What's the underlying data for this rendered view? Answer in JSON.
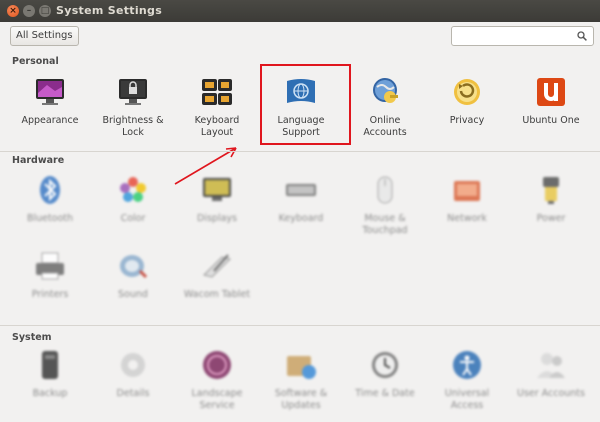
{
  "window": {
    "title": "System Settings"
  },
  "toolbar": {
    "all_settings": "All Settings",
    "search_placeholder": ""
  },
  "sections": {
    "personal": "Personal",
    "hardware": "Hardware",
    "system": "System"
  },
  "personal": [
    {
      "label": "Appearance"
    },
    {
      "label": "Brightness &\nLock"
    },
    {
      "label": "Keyboard\nLayout"
    },
    {
      "label": "Language\nSupport"
    },
    {
      "label": "Online\nAccounts"
    },
    {
      "label": "Privacy"
    },
    {
      "label": "Ubuntu One"
    }
  ],
  "hardware": [
    {
      "label": "Bluetooth"
    },
    {
      "label": "Color"
    },
    {
      "label": "Displays"
    },
    {
      "label": "Keyboard"
    },
    {
      "label": "Mouse &\nTouchpad"
    },
    {
      "label": "Network"
    },
    {
      "label": "Power"
    },
    {
      "label": "Printers"
    },
    {
      "label": "Sound"
    },
    {
      "label": "Wacom Tablet"
    }
  ],
  "system": [
    {
      "label": "Backup"
    },
    {
      "label": "Details"
    },
    {
      "label": "Landscape\nService"
    },
    {
      "label": "Software &\nUpdates"
    },
    {
      "label": "Time & Date"
    },
    {
      "label": "Universal\nAccess"
    },
    {
      "label": "User Accounts"
    }
  ],
  "colors": {
    "highlight": "#e0161e",
    "accent_orange": "#dd4814"
  }
}
